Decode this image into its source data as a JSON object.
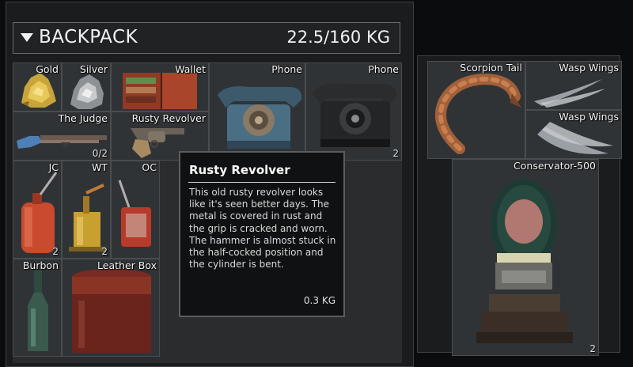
{
  "backpack": {
    "title": "BACKPACK",
    "weight": "22.5/160 KG"
  },
  "items": {
    "gold": {
      "name": "Gold"
    },
    "silver": {
      "name": "Silver"
    },
    "wallet": {
      "name": "Wallet"
    },
    "phone1": {
      "name": "Phone"
    },
    "phone2": {
      "name": "Phone",
      "qty": "2"
    },
    "judge": {
      "name": "The Judge",
      "qty": "0/2"
    },
    "revolver": {
      "name": "Rusty Revolver"
    },
    "jc": {
      "name": "JC",
      "qty": "2"
    },
    "wt": {
      "name": "WT",
      "qty": "2"
    },
    "oc": {
      "name": "OC"
    },
    "burbon": {
      "name": "Burbon"
    },
    "leather_box": {
      "name": "Leather Box"
    }
  },
  "side_items": {
    "scorpion_tail": {
      "name": "Scorpion Tail"
    },
    "wasp_wings_1": {
      "name": "Wasp Wings"
    },
    "wasp_wings_2": {
      "name": "Wasp Wings"
    },
    "conservator": {
      "name": "Conservator-500",
      "qty": "2"
    }
  },
  "tooltip": {
    "title": "Rusty Revolver",
    "description": "This old rusty revolver looks like it's seen better days. The metal is covered in rust and the grip is cracked and worn. The hammer is almost stuck in the half-cocked position and the cylinder is bent.",
    "weight": "0.3 KG"
  },
  "colors": {
    "panel_bg": "#1a1c1e",
    "cell_bg": "#303336",
    "border": "#4a4d50",
    "tooltip_bg": "#101112"
  }
}
